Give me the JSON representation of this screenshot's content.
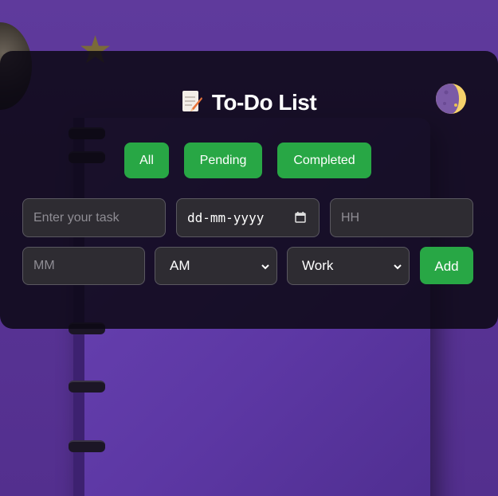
{
  "app": {
    "title": "To-Do List",
    "title_icon": "memo-icon",
    "theme_toggle_icon": "moon-icon"
  },
  "filters": [
    {
      "label": "All"
    },
    {
      "label": "Pending"
    },
    {
      "label": "Completed"
    }
  ],
  "form": {
    "task_placeholder": "Enter your task",
    "date_placeholder": "dd-mm-yyyy",
    "hour_placeholder": "HH",
    "minute_placeholder": "MM",
    "ampm_selected": "AM",
    "category_selected": "Work",
    "add_label": "Add"
  },
  "colors": {
    "accent": "#28a745",
    "card": "#0c0814",
    "background": "#5a3597"
  }
}
